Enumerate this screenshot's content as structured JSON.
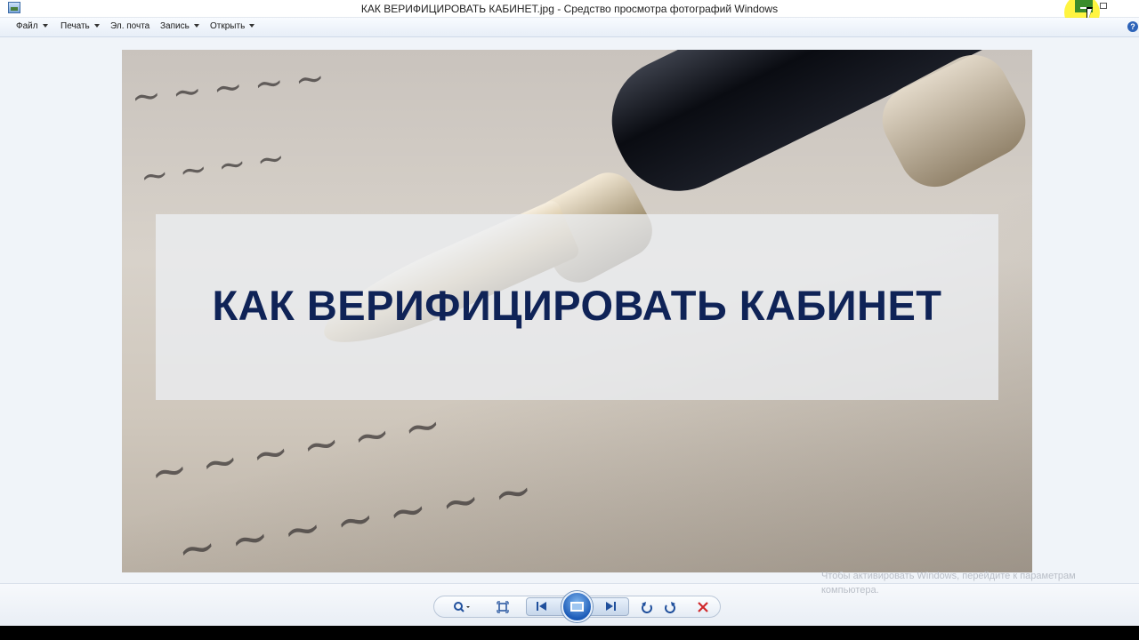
{
  "window": {
    "title": "КАК ВЕРИФИЦИРОВАТЬ КАБИНЕТ.jpg - Средство просмотра фотографий Windows"
  },
  "menu": {
    "items": [
      {
        "label": "Файл",
        "has_dropdown": true
      },
      {
        "label": "Печать",
        "has_dropdown": true
      },
      {
        "label": "Эл. почта",
        "has_dropdown": false
      },
      {
        "label": "Запись",
        "has_dropdown": true
      },
      {
        "label": "Открыть",
        "has_dropdown": true
      }
    ],
    "help_label": "?"
  },
  "photo": {
    "banner_text": "КАК ВЕРИФИЦИРОВАТЬ КАБИНЕТ",
    "banner_text_color": "#0f2357"
  },
  "activation_watermark": "Чтобы активировать Windows, перейдите к параметрам компьютера.",
  "toolbar": {
    "icons": [
      "zoom-icon",
      "actual-size-icon",
      "previous-icon",
      "slideshow-icon",
      "next-icon",
      "rotate-left-icon",
      "rotate-right-icon",
      "delete-icon"
    ],
    "accent_color": "#1f4f9c",
    "delete_color": "#d0272a"
  }
}
